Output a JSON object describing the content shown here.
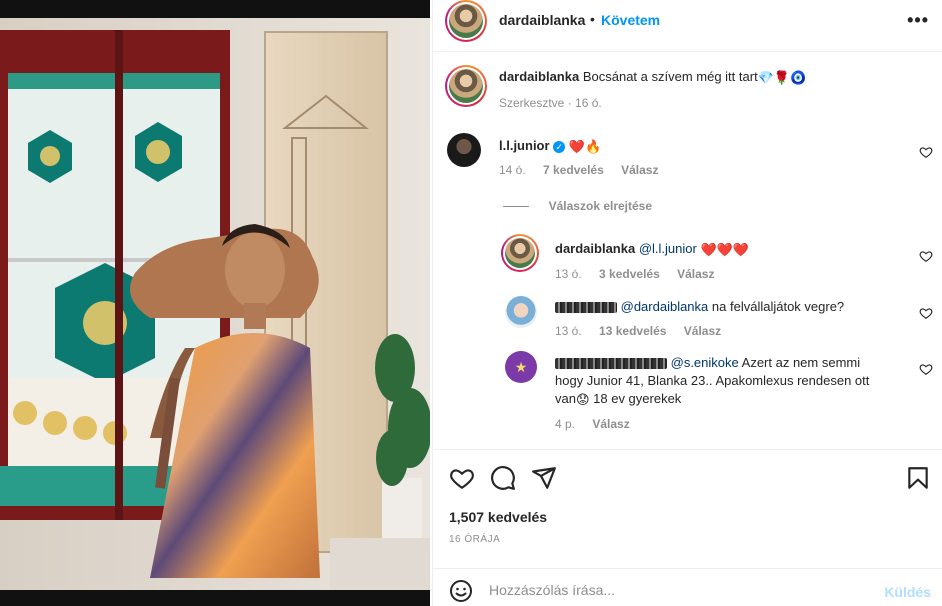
{
  "post": {
    "username": "dardaiblanka",
    "follow_label": "Követem",
    "more_label": "•••",
    "dot": "•"
  },
  "caption": {
    "username": "dardaiblanka",
    "text": "Bocsánat a szívem még itt tart",
    "emojis": "💎🌹🧿",
    "meta": "Szerkesztve · 16 ó."
  },
  "comments": [
    {
      "username": "l.l.junior",
      "verified": true,
      "text": "❤️🔥",
      "time": "14 ó.",
      "likes": "7 kedvelés",
      "reply": "Válasz"
    }
  ],
  "hide_replies": "Válaszok elrejtése",
  "replies": [
    {
      "username": "dardaiblanka",
      "mention": "@l.l.junior",
      "text": "❤️❤️❤️",
      "time": "13 ó.",
      "likes": "3 kedvelés",
      "reply": "Válasz"
    },
    {
      "mention": "@dardaiblanka",
      "text": "na felvállaljátok vegre?",
      "time": "13 ó.",
      "likes": "13 kedvelés",
      "reply": "Válasz"
    },
    {
      "mention": "@s.enikoke",
      "text_line1": "Azert az nem semmi",
      "text_line2": "hogy Junior 41, Blanka 23.. Apakomlexus rendesen ott",
      "text_line3a": "van",
      "text_line3_emoji": "😟",
      "text_line3b": " 18 ev gyerekek",
      "time": "4 p.",
      "reply": "Válasz"
    }
  ],
  "actions": {
    "likes": "1,507 kedvelés",
    "time": "16 ÓRÁJA"
  },
  "composer": {
    "placeholder": "Hozzászólás írása...",
    "send": "Küldés"
  },
  "icons": [
    "heart-icon",
    "comment-icon",
    "share-icon",
    "bookmark-icon",
    "emoji-icon",
    "more-icon"
  ]
}
